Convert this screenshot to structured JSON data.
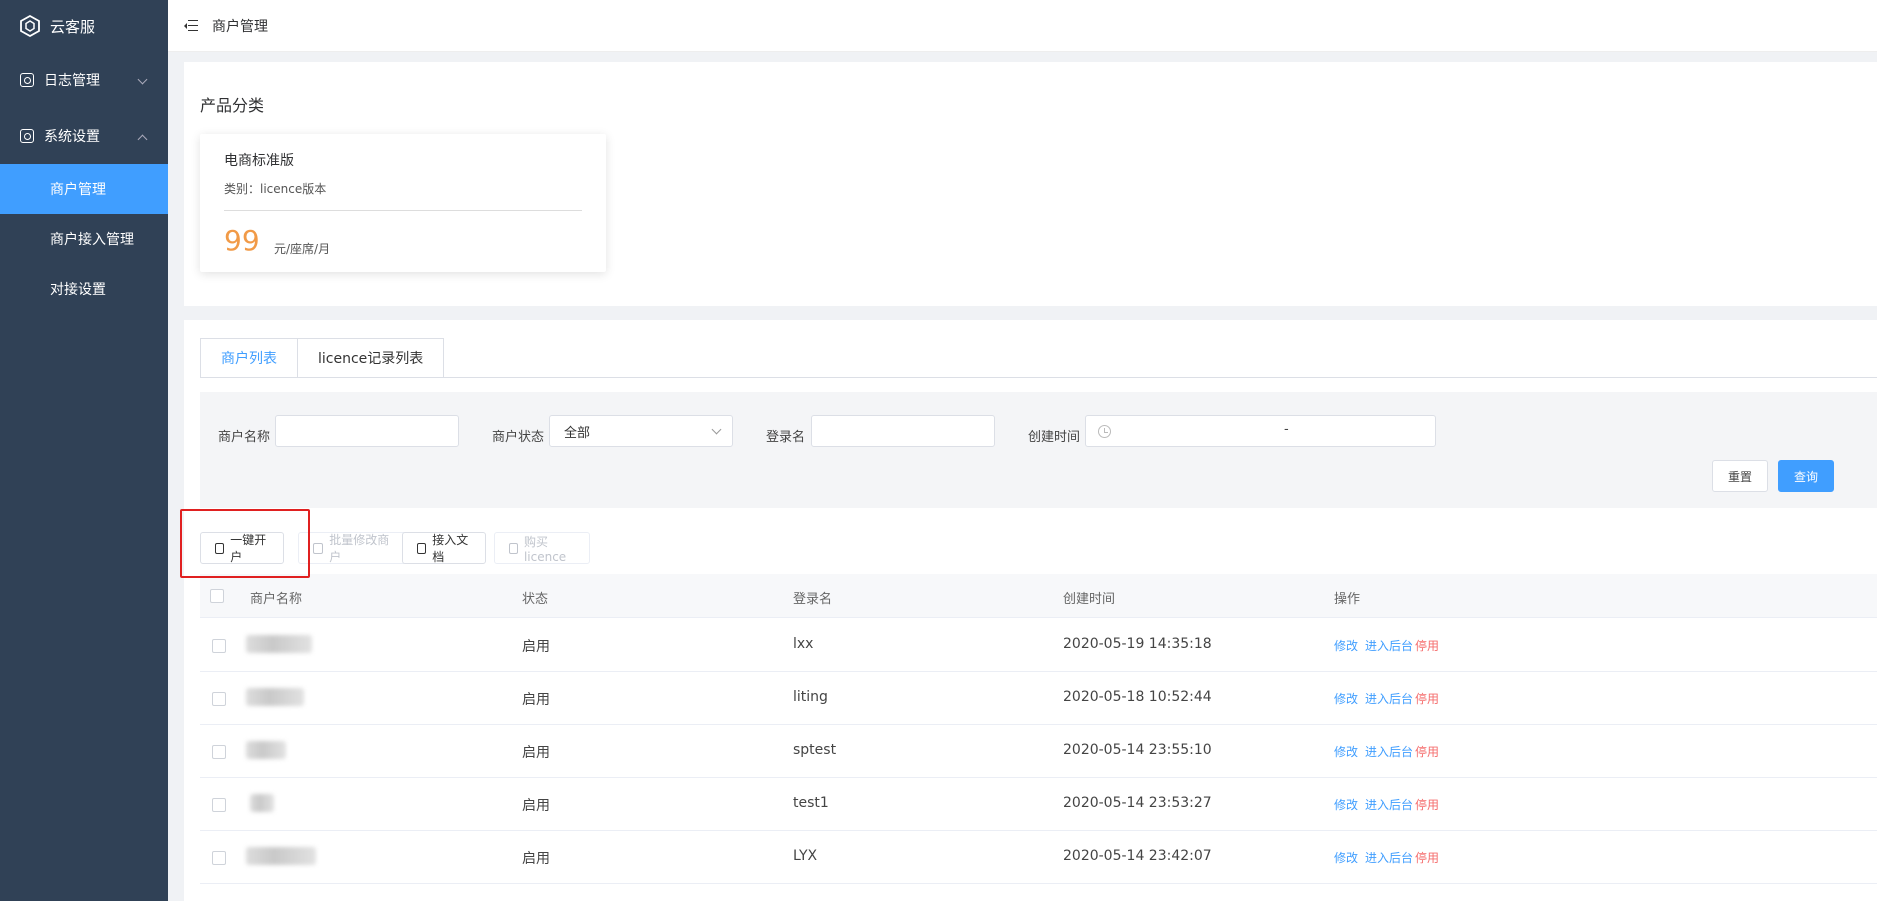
{
  "app": {
    "name": "云客服"
  },
  "sidebar": {
    "groups": [
      {
        "label": "日志管理",
        "expanded": false
      },
      {
        "label": "系统设置",
        "expanded": true
      }
    ],
    "items": [
      {
        "label": "商户管理",
        "active": true
      },
      {
        "label": "商户接入管理",
        "active": false
      },
      {
        "label": "对接设置",
        "active": false
      }
    ]
  },
  "header": {
    "breadcrumb": "商户管理"
  },
  "product_section": {
    "title": "产品分类",
    "card": {
      "name": "电商标准版",
      "category": "类别：licence版本",
      "price": "99",
      "unit": "元/座席/月"
    }
  },
  "tabs": [
    {
      "label": "商户列表",
      "active": true
    },
    {
      "label": "licence记录列表",
      "active": false
    }
  ],
  "filters": {
    "merchant_name_label": "商户名称",
    "merchant_status_label": "商户状态",
    "merchant_status_value": "全部",
    "login_label": "登录名",
    "created_label": "创建时间",
    "date_separator": "-",
    "reset_label": "重置",
    "query_label": "查询"
  },
  "toolbar": {
    "open_account": "一键开户",
    "batch_edit": "批量修改商户",
    "access_doc": "接入文档",
    "buy_licence": "购买licence"
  },
  "table": {
    "columns": [
      "商户名称",
      "状态",
      "登录名",
      "创建时间",
      "操作"
    ],
    "actions": {
      "edit": "修改",
      "enter": "进入后台",
      "disable": "停用"
    },
    "rows": [
      {
        "status": "启用",
        "login": "lxx",
        "created": "2020-05-19 14:35:18"
      },
      {
        "status": "启用",
        "login": "liting",
        "created": "2020-05-18 10:52:44"
      },
      {
        "status": "启用",
        "login": "sptest",
        "created": "2020-05-14 23:55:10"
      },
      {
        "status": "启用",
        "login": "test1",
        "created": "2020-05-14 23:53:27"
      },
      {
        "status": "启用",
        "login": "LYX",
        "created": "2020-05-14 23:42:07"
      }
    ]
  },
  "colors": {
    "sidebar_bg": "#304156",
    "accent": "#409eff",
    "price": "#f19a47",
    "danger": "#f56c6c",
    "highlight": "#e02020"
  }
}
